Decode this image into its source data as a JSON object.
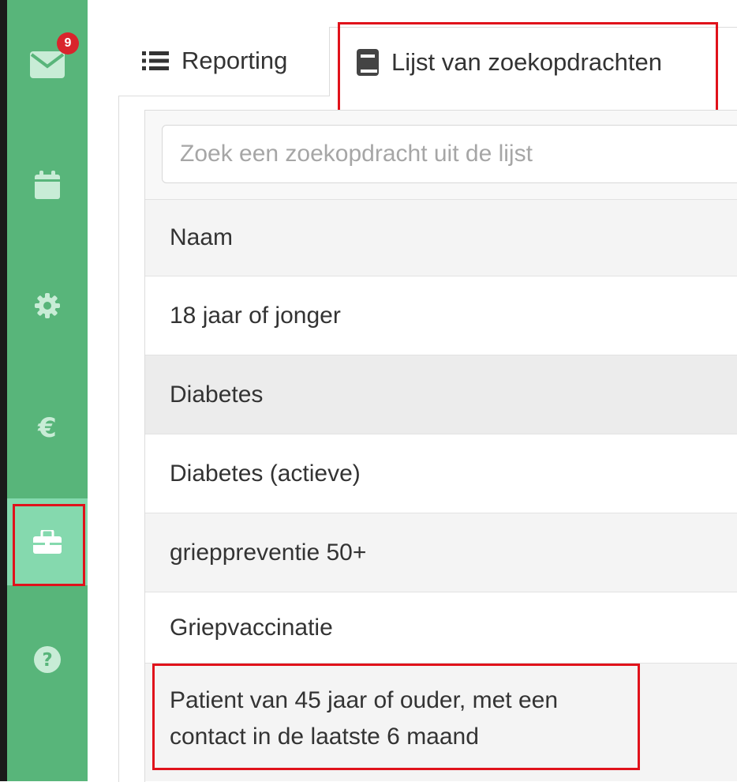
{
  "sidebar": {
    "items": [
      {
        "icon": "envelope-icon",
        "badge": "9"
      },
      {
        "icon": "calendar-icon"
      },
      {
        "icon": "gear-icon"
      },
      {
        "icon": "euro-icon",
        "glyph": "€"
      },
      {
        "icon": "toolbox-icon",
        "active": true
      },
      {
        "icon": "question-icon"
      }
    ]
  },
  "tabs": [
    {
      "label": "Reporting",
      "icon": "list-icon"
    },
    {
      "label": "Lijst van zoekopdrachten",
      "icon": "book-icon",
      "active": true
    }
  ],
  "search": {
    "placeholder": "Zoek een zoekopdracht uit de lijst",
    "value": ""
  },
  "table": {
    "header": "Naam",
    "rows": [
      "18 jaar of jonger",
      "Diabetes",
      "Diabetes (actieve)",
      "grieppreventie 50+",
      "Griepvaccinatie",
      "Patient van 45 jaar of ouder, met een contact in de laatste 6 maand"
    ]
  },
  "colors": {
    "sidebar": "#58b57a",
    "sidebar_active": "#85d9ae",
    "highlight": "#e0121b",
    "badge": "#d9242c"
  }
}
